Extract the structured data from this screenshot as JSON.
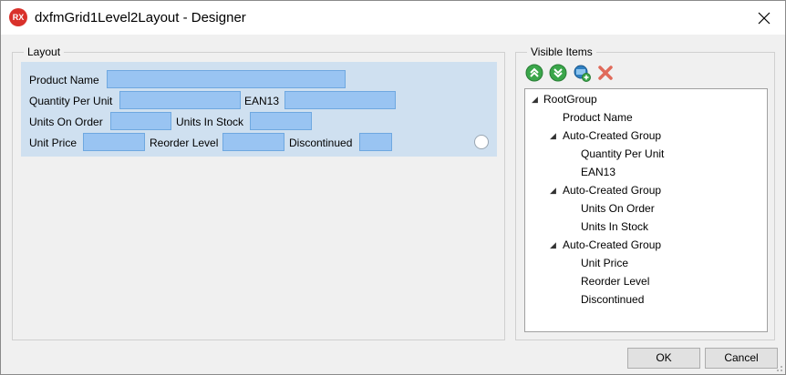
{
  "window": {
    "icon_text": "RX",
    "title": "dxfmGrid1Level2Layout - Designer"
  },
  "layout": {
    "caption": "Layout",
    "labels": {
      "product_name": "Product Name",
      "quantity_per_unit": "Quantity Per Unit",
      "ean13": "EAN13",
      "units_on_order": "Units On Order",
      "units_in_stock": "Units In Stock",
      "unit_price": "Unit Price",
      "reorder_level": "Reorder Level",
      "discontinued": "Discontinued"
    }
  },
  "visible_items": {
    "caption": "Visible Items",
    "toolbar_icons": [
      "move-up-icon",
      "move-down-icon",
      "add-group-icon",
      "delete-icon"
    ],
    "tree": {
      "root": "RootGroup",
      "product_name": "Product Name",
      "group1": "Auto-Created Group",
      "quantity_per_unit": "Quantity Per Unit",
      "ean13": "EAN13",
      "group2": "Auto-Created Group",
      "units_on_order": "Units On Order",
      "units_in_stock": "Units In Stock",
      "group3": "Auto-Created Group",
      "unit_price": "Unit Price",
      "reorder_level": "Reorder Level",
      "discontinued": "Discontinued"
    }
  },
  "buttons": {
    "ok": "OK",
    "cancel": "Cancel"
  },
  "colors": {
    "layout_bg": "#cfe0f0",
    "field_fill": "#99c4f2",
    "app_icon": "#d9312b"
  }
}
